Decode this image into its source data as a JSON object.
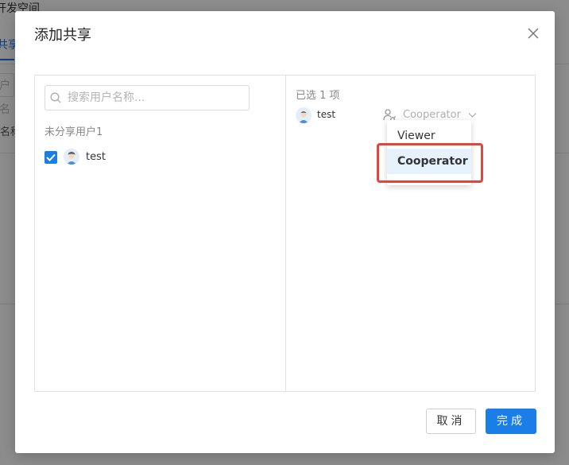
{
  "background": {
    "title": "开发空间",
    "tab": "共享",
    "input_hint": "户名",
    "column": "名称"
  },
  "dialog": {
    "title": "添加共享",
    "close_icon": "close-icon",
    "left_pane": {
      "search_placeholder": "搜索用户名称...",
      "section_label": "未分享用户1",
      "users": [
        {
          "name": "test",
          "checked": true
        }
      ]
    },
    "right_pane": {
      "selected_label": "已选 1 项",
      "selected_users": [
        {
          "name": "test",
          "role": "Cooperator"
        }
      ]
    },
    "role_dropdown": {
      "options": [
        "Viewer",
        "Cooperator"
      ],
      "selected": "Cooperator"
    },
    "buttons": {
      "cancel": "取消",
      "done": "完成"
    }
  },
  "colors": {
    "primary": "#1a7ee8",
    "highlight": "#e0473c",
    "dropdown_selected_bg": "#e6f3fd"
  }
}
